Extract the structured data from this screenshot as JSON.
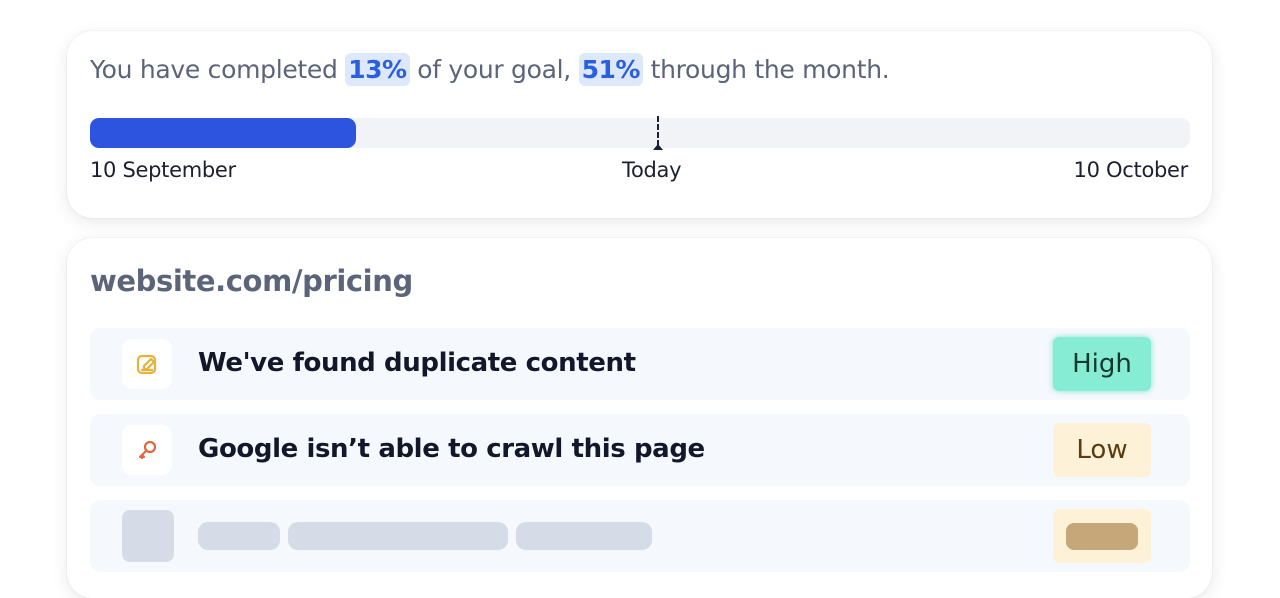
{
  "goal": {
    "prefix": "You have completed",
    "completed_pct": "13%",
    "middle": "of your goal,",
    "month_pct": "51%",
    "suffix": "through the month.",
    "progress_completed": 0.242,
    "progress_today": 0.515,
    "start_label": "10 September",
    "today_label": "Today",
    "end_label": "10 October",
    "fill_color": "#2d54df"
  },
  "pricing": {
    "url": "website.com/pricing",
    "issues": [
      {
        "icon": "edit-note-icon",
        "text": "We've found duplicate content",
        "priority": "High",
        "priority_color": "#86ecd3"
      },
      {
        "icon": "key-icon",
        "text": "Google isn’t able to crawl this page",
        "priority": "Low",
        "priority_color": "#fdf1d8"
      },
      {
        "icon": "loading-placeholder",
        "text": "",
        "priority": "",
        "priority_color": "#fdf1d8"
      }
    ]
  }
}
